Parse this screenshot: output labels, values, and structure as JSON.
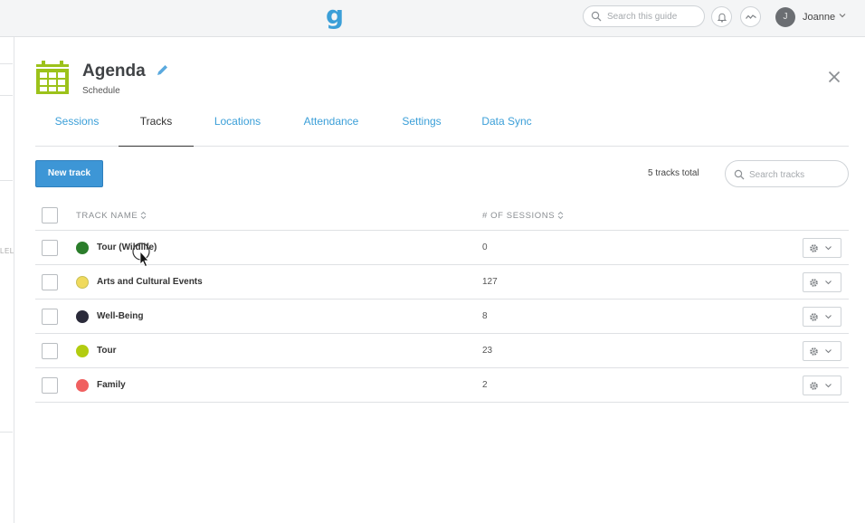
{
  "topbar": {
    "logo": "g",
    "search_placeholder": "Search this guide",
    "user_initial": "J",
    "user_name": "Joanne",
    "icons": [
      "search-icon",
      "bell-icon",
      "activity-icon",
      "chevron-down-icon"
    ]
  },
  "left_panel": {
    "fragment_text": "LEL"
  },
  "header": {
    "title": "Agenda",
    "subtitle": "Schedule",
    "icon": "calendar-icon",
    "accent_color": "#9cc21a"
  },
  "tabs": [
    {
      "label": "Sessions",
      "active": false
    },
    {
      "label": "Tracks",
      "active": true
    },
    {
      "label": "Locations",
      "active": false
    },
    {
      "label": "Attendance",
      "active": false
    },
    {
      "label": "Settings",
      "active": false
    },
    {
      "label": "Data Sync",
      "active": false
    }
  ],
  "toolbar": {
    "new_track_label": "New track",
    "total_label": "5 tracks total",
    "search_placeholder": "Search tracks"
  },
  "table": {
    "columns": [
      "TRACK NAME",
      "# OF SESSIONS"
    ],
    "rows": [
      {
        "name": "Tour (Wildlife)",
        "sessions": "0",
        "color": "#2b7d2b"
      },
      {
        "name": "Arts and Cultural Events",
        "sessions": "127",
        "color": "#f0da5c"
      },
      {
        "name": "Well-Being",
        "sessions": "8",
        "color": "#2a2a3a"
      },
      {
        "name": "Tour",
        "sessions": "23",
        "color": "#b2cc10"
      },
      {
        "name": "Family",
        "sessions": "2",
        "color": "#f06060"
      }
    ]
  },
  "colors": {
    "link": "#3b9fd8",
    "primary_button": "#3d96d6"
  }
}
